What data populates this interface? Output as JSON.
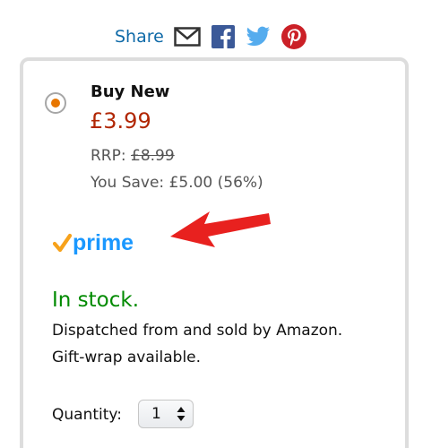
{
  "share": {
    "label": "Share",
    "icons": [
      "email-icon",
      "facebook-icon",
      "twitter-icon",
      "pinterest-icon"
    ]
  },
  "offer": {
    "title": "Buy New",
    "price": "£3.99",
    "rrp_label": "RRP:",
    "rrp_value": "£8.99",
    "you_save": "You Save: £5.00 (56%)",
    "selected": true
  },
  "prime": {
    "logo_text": "prime"
  },
  "availability": {
    "stock": "In stock.",
    "dispatch": "Dispatched from and sold by Amazon.",
    "gift_wrap": "Gift-wrap available."
  },
  "quantity": {
    "label": "Quantity:",
    "value": "1"
  },
  "colors": {
    "link": "#0f6aa8",
    "price": "#b12704",
    "stock": "#008a00",
    "radio_selected": "#e77600",
    "arrow": "#e8211f",
    "prime_blue": "#1a98ff",
    "prime_check": "#f7a21b"
  }
}
